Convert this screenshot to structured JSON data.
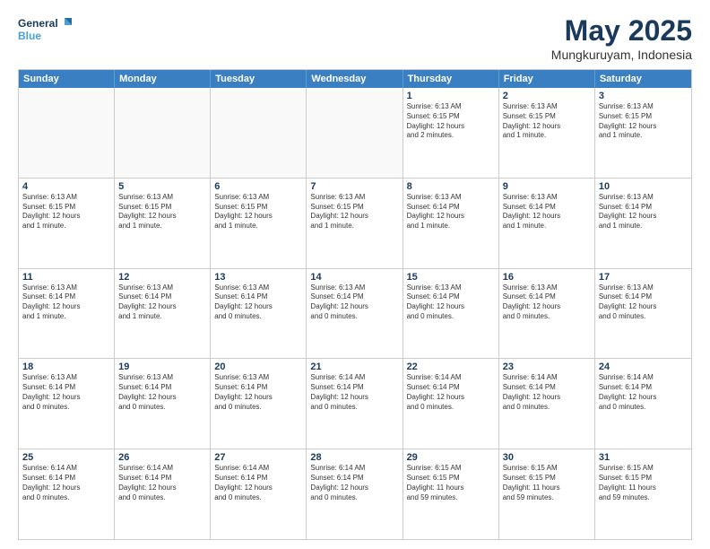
{
  "logo": {
    "line1": "General",
    "line2": "Blue"
  },
  "title": "May 2025",
  "subtitle": "Mungkuruyam, Indonesia",
  "days": [
    "Sunday",
    "Monday",
    "Tuesday",
    "Wednesday",
    "Thursday",
    "Friday",
    "Saturday"
  ],
  "rows": [
    [
      {
        "day": "",
        "empty": true
      },
      {
        "day": "",
        "empty": true
      },
      {
        "day": "",
        "empty": true
      },
      {
        "day": "",
        "empty": true
      },
      {
        "day": "1",
        "info": "Sunrise: 6:13 AM\nSunset: 6:15 PM\nDaylight: 12 hours\nand 2 minutes."
      },
      {
        "day": "2",
        "info": "Sunrise: 6:13 AM\nSunset: 6:15 PM\nDaylight: 12 hours\nand 1 minute."
      },
      {
        "day": "3",
        "info": "Sunrise: 6:13 AM\nSunset: 6:15 PM\nDaylight: 12 hours\nand 1 minute."
      }
    ],
    [
      {
        "day": "4",
        "info": "Sunrise: 6:13 AM\nSunset: 6:15 PM\nDaylight: 12 hours\nand 1 minute."
      },
      {
        "day": "5",
        "info": "Sunrise: 6:13 AM\nSunset: 6:15 PM\nDaylight: 12 hours\nand 1 minute."
      },
      {
        "day": "6",
        "info": "Sunrise: 6:13 AM\nSunset: 6:15 PM\nDaylight: 12 hours\nand 1 minute."
      },
      {
        "day": "7",
        "info": "Sunrise: 6:13 AM\nSunset: 6:15 PM\nDaylight: 12 hours\nand 1 minute."
      },
      {
        "day": "8",
        "info": "Sunrise: 6:13 AM\nSunset: 6:14 PM\nDaylight: 12 hours\nand 1 minute."
      },
      {
        "day": "9",
        "info": "Sunrise: 6:13 AM\nSunset: 6:14 PM\nDaylight: 12 hours\nand 1 minute."
      },
      {
        "day": "10",
        "info": "Sunrise: 6:13 AM\nSunset: 6:14 PM\nDaylight: 12 hours\nand 1 minute."
      }
    ],
    [
      {
        "day": "11",
        "info": "Sunrise: 6:13 AM\nSunset: 6:14 PM\nDaylight: 12 hours\nand 1 minute."
      },
      {
        "day": "12",
        "info": "Sunrise: 6:13 AM\nSunset: 6:14 PM\nDaylight: 12 hours\nand 1 minute."
      },
      {
        "day": "13",
        "info": "Sunrise: 6:13 AM\nSunset: 6:14 PM\nDaylight: 12 hours\nand 0 minutes."
      },
      {
        "day": "14",
        "info": "Sunrise: 6:13 AM\nSunset: 6:14 PM\nDaylight: 12 hours\nand 0 minutes."
      },
      {
        "day": "15",
        "info": "Sunrise: 6:13 AM\nSunset: 6:14 PM\nDaylight: 12 hours\nand 0 minutes."
      },
      {
        "day": "16",
        "info": "Sunrise: 6:13 AM\nSunset: 6:14 PM\nDaylight: 12 hours\nand 0 minutes."
      },
      {
        "day": "17",
        "info": "Sunrise: 6:13 AM\nSunset: 6:14 PM\nDaylight: 12 hours\nand 0 minutes."
      }
    ],
    [
      {
        "day": "18",
        "info": "Sunrise: 6:13 AM\nSunset: 6:14 PM\nDaylight: 12 hours\nand 0 minutes."
      },
      {
        "day": "19",
        "info": "Sunrise: 6:13 AM\nSunset: 6:14 PM\nDaylight: 12 hours\nand 0 minutes."
      },
      {
        "day": "20",
        "info": "Sunrise: 6:13 AM\nSunset: 6:14 PM\nDaylight: 12 hours\nand 0 minutes."
      },
      {
        "day": "21",
        "info": "Sunrise: 6:14 AM\nSunset: 6:14 PM\nDaylight: 12 hours\nand 0 minutes."
      },
      {
        "day": "22",
        "info": "Sunrise: 6:14 AM\nSunset: 6:14 PM\nDaylight: 12 hours\nand 0 minutes."
      },
      {
        "day": "23",
        "info": "Sunrise: 6:14 AM\nSunset: 6:14 PM\nDaylight: 12 hours\nand 0 minutes."
      },
      {
        "day": "24",
        "info": "Sunrise: 6:14 AM\nSunset: 6:14 PM\nDaylight: 12 hours\nand 0 minutes."
      }
    ],
    [
      {
        "day": "25",
        "info": "Sunrise: 6:14 AM\nSunset: 6:14 PM\nDaylight: 12 hours\nand 0 minutes."
      },
      {
        "day": "26",
        "info": "Sunrise: 6:14 AM\nSunset: 6:14 PM\nDaylight: 12 hours\nand 0 minutes."
      },
      {
        "day": "27",
        "info": "Sunrise: 6:14 AM\nSunset: 6:14 PM\nDaylight: 12 hours\nand 0 minutes."
      },
      {
        "day": "28",
        "info": "Sunrise: 6:14 AM\nSunset: 6:14 PM\nDaylight: 12 hours\nand 0 minutes."
      },
      {
        "day": "29",
        "info": "Sunrise: 6:15 AM\nSunset: 6:15 PM\nDaylight: 11 hours\nand 59 minutes."
      },
      {
        "day": "30",
        "info": "Sunrise: 6:15 AM\nSunset: 6:15 PM\nDaylight: 11 hours\nand 59 minutes."
      },
      {
        "day": "31",
        "info": "Sunrise: 6:15 AM\nSunset: 6:15 PM\nDaylight: 11 hours\nand 59 minutes."
      }
    ]
  ]
}
